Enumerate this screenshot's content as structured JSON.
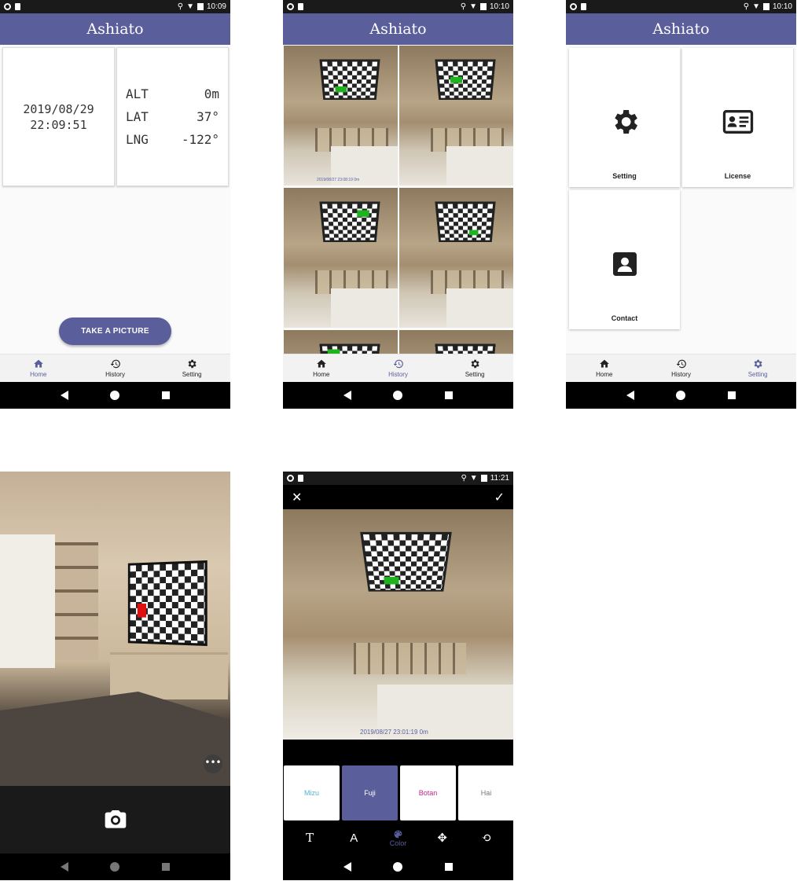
{
  "colors": {
    "primary": "#5a5f9c",
    "statusbar": "#1a1a1a",
    "marker_green": "#1fb31f",
    "marker_red": "#e01010"
  },
  "home": {
    "status_time": "10:09",
    "title": "Ashiato",
    "date": "2019/08/29",
    "time": "22:09:51",
    "alt_label": "ALT",
    "alt_value": "0m",
    "lat_label": "LAT",
    "lat_value": "37°",
    "lng_label": "LNG",
    "lng_value": "-122°",
    "take_picture": "TAKE A PICTURE"
  },
  "history": {
    "status_time": "10:10",
    "title": "Ashiato",
    "thumb_stamp": "2019/08/27 23:08:19 0m"
  },
  "setting": {
    "status_time": "10:10",
    "title": "Ashiato",
    "cards": [
      {
        "label": "Setting",
        "icon": "gear-icon"
      },
      {
        "label": "License",
        "icon": "id-card-icon"
      },
      {
        "label": "Contact",
        "icon": "contact-icon"
      }
    ]
  },
  "bottom_nav": {
    "home": "Home",
    "history": "History",
    "setting": "Setting"
  },
  "camera": {
    "more": "•••"
  },
  "editor": {
    "status_time": "11:21",
    "stamp": "2019/08/27 23:01:19 0m",
    "swatches": [
      {
        "label": "Mizu",
        "color": "#53b4d6"
      },
      {
        "label": "Fuji",
        "color": "#ffffff"
      },
      {
        "label": "Botan",
        "color": "#c0268a"
      },
      {
        "label": "Hai",
        "color": "#777777"
      }
    ],
    "tools": {
      "text": "T",
      "font": "A",
      "color": "Color"
    }
  }
}
